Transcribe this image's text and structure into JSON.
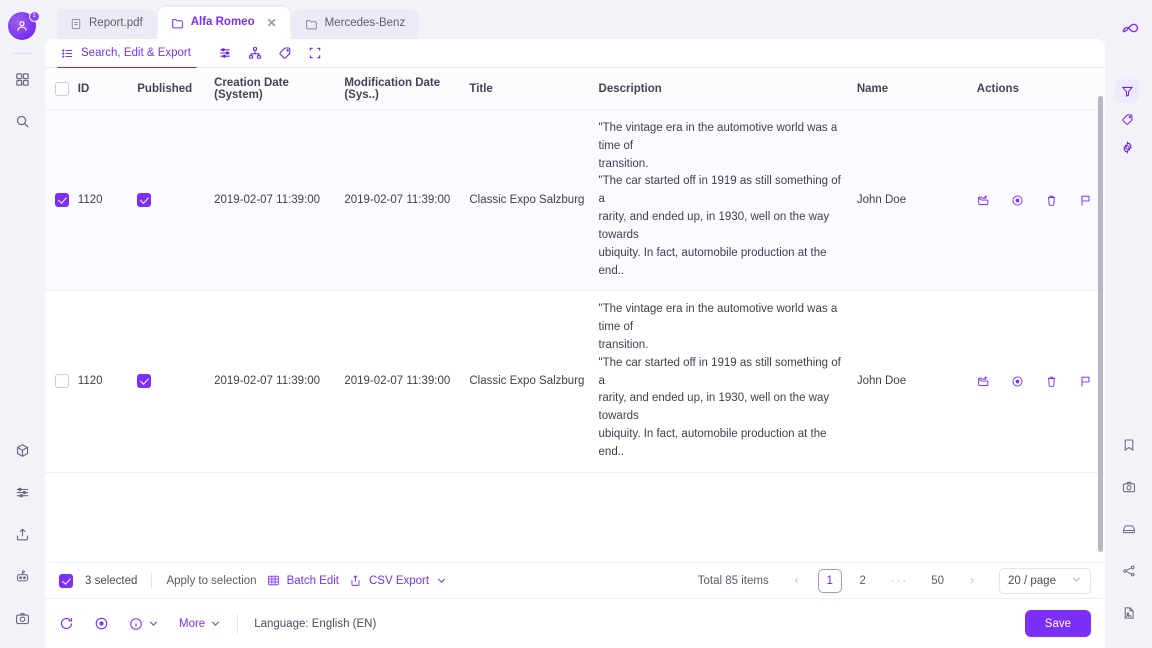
{
  "window": {
    "tabs": [
      {
        "label": "Report.pdf",
        "icon": "file-icon",
        "active": false,
        "closable": false
      },
      {
        "label": "Alfa Romeo",
        "icon": "folder-icon",
        "active": true,
        "closable": true
      },
      {
        "label": "Mercedes-Benz",
        "icon": "folder-icon",
        "active": false,
        "closable": false
      }
    ]
  },
  "subtoolbar": {
    "active_tab": "Search, Edit & Export",
    "icons": [
      "list-icon",
      "sliders-icon",
      "sitemap-icon",
      "tag-icon",
      "expand-icon"
    ]
  },
  "panel_tools": [
    {
      "name": "filter-icon",
      "active": true
    },
    {
      "name": "tag-icon",
      "active": false
    },
    {
      "name": "gear-icon",
      "active": false
    }
  ],
  "table": {
    "columns": [
      "ID",
      "Published",
      "Creation Date (System)",
      "Modification Date (Sys..)",
      "Title",
      "Description",
      "Name",
      "Actions"
    ],
    "header_checkbox": false,
    "rows": [
      {
        "selected": true,
        "id": "1120",
        "published": true,
        "creation_date": "2019-02-07 11:39:00",
        "modification_date": "2019-02-07 11:39:00",
        "title": "Classic Expo Salzburg",
        "description": [
          "\"The vintage era in the automotive world was a time of",
          "transition.",
          "\"The car started off in 1919 as still something of a",
          "rarity, and ended up, in 1930, well on the way towards",
          "ubiquity. In fact, automobile production at the end.."
        ],
        "name": "John Doe",
        "actions": [
          "export-icon",
          "preview-icon",
          "delete-icon",
          "flag-icon"
        ]
      },
      {
        "selected": false,
        "id": "1120",
        "published": true,
        "creation_date": "2019-02-07 11:39:00",
        "modification_date": "2019-02-07 11:39:00",
        "title": "Classic Expo Salzburg",
        "description": [
          "\"The vintage era in the automotive world was a time of",
          "transition.",
          "\"The car started off in 1919 as still something of a",
          "rarity, and ended up, in 1930, well on the way towards",
          "ubiquity. In fact, automobile production at the end.."
        ],
        "name": "John Doe",
        "actions": [
          "export-icon",
          "preview-icon",
          "delete-icon",
          "flag-icon"
        ]
      }
    ]
  },
  "selection_bar": {
    "checkbox_checked": true,
    "selected_label": "3 selected",
    "apply_to_selection": "Apply to selection",
    "batch_edit": "Batch Edit",
    "csv_export": "CSV Export"
  },
  "pagination": {
    "total": "Total 85 items",
    "prev": "‹",
    "next": "›",
    "pages": [
      "1",
      "2",
      "···",
      "50"
    ],
    "current_page": "1",
    "page_size": "20 / page"
  },
  "footer": {
    "refresh_icon": "refresh-icon",
    "target_icon": "target-icon",
    "info_icon": "info-icon",
    "more_label": "More",
    "language": "Language: English (EN)",
    "save_label": "Save"
  },
  "rail_left": {
    "badge": "1",
    "top_icons": [
      "grid-icon",
      "search-icon"
    ],
    "bottom_icons": [
      "cube-icon",
      "sliders-icon",
      "upload-icon",
      "robot-icon",
      "camera-icon"
    ]
  },
  "rail_right": {
    "logo": "∞",
    "bottom_icons": [
      "bookmark-icon",
      "camera-icon",
      "car-icon",
      "share-network-icon",
      "file-image-icon"
    ]
  },
  "colors": {
    "accent": "#7b2ff7",
    "accent_dark": "#6b23e8",
    "app_bg": "#f3f2f9",
    "panel_bg": "#ffffff",
    "text": "#3f3e52",
    "muted": "#5a5970"
  }
}
